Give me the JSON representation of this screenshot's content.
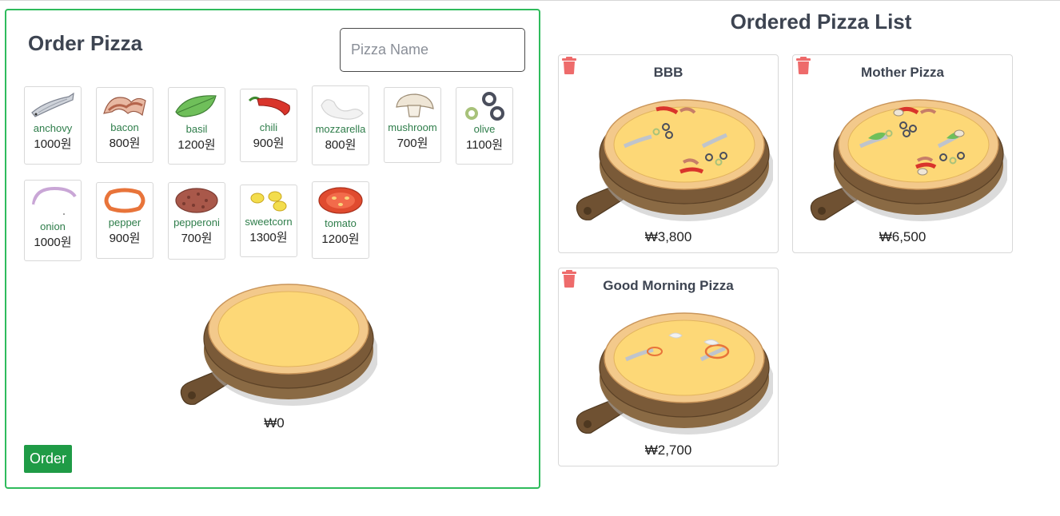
{
  "order": {
    "title": "Order Pizza",
    "name_placeholder": "Pizza Name",
    "total": "₩0",
    "order_label": "Order"
  },
  "toppings": [
    {
      "name": "anchovy",
      "price": "1000원",
      "icon": "anchovy-icon"
    },
    {
      "name": "bacon",
      "price": "800원",
      "icon": "bacon-icon"
    },
    {
      "name": "basil",
      "price": "1200원",
      "icon": "basil-icon"
    },
    {
      "name": "chili",
      "price": "900원",
      "icon": "chili-icon"
    },
    {
      "name": "mozzarella",
      "price": "800원",
      "icon": "mozzarella-icon"
    },
    {
      "name": "mushroom",
      "price": "700원",
      "icon": "mushroom-icon"
    },
    {
      "name": "olive",
      "price": "1100원",
      "icon": "olive-icon"
    },
    {
      "name": "onion",
      "price": "1000원",
      "icon": "onion-icon"
    },
    {
      "name": "pepper",
      "price": "900원",
      "icon": "pepper-icon"
    },
    {
      "name": "pepperoni",
      "price": "700원",
      "icon": "pepperoni-icon"
    },
    {
      "name": "sweetcorn",
      "price": "1300원",
      "icon": "sweetcorn-icon"
    },
    {
      "name": "tomato",
      "price": "1200원",
      "icon": "tomato-icon"
    }
  ],
  "ordered": {
    "title": "Ordered Pizza List",
    "pizzas": [
      {
        "name": "BBB",
        "price": "₩3,800"
      },
      {
        "name": "Mother Pizza",
        "price": "₩6,500"
      },
      {
        "name": "Good Morning Pizza",
        "price": "₩2,700"
      }
    ]
  },
  "colors": {
    "panel_border": "#2fbb5c",
    "order_button": "#1f9b46",
    "trash_icon": "#ee6b6b",
    "topping_name": "#2e7d4a",
    "heading": "#3d4451",
    "cheese": "#fdd877",
    "crust": "#f3c98b",
    "board": "#7a5a38"
  }
}
